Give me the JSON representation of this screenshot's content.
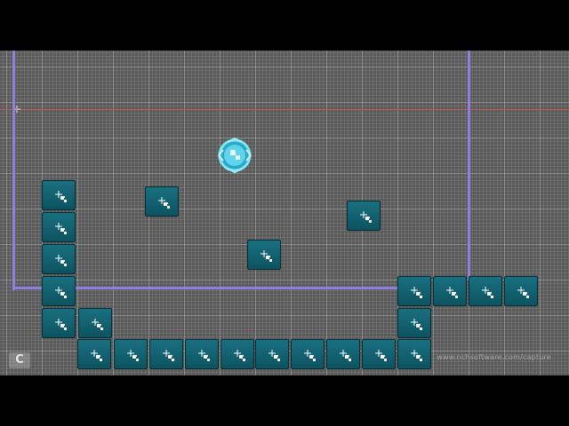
{
  "scene": {
    "background": "#5a5a5a",
    "boundary_color": "#8f7fe0",
    "guide_color": "#dc5a5a",
    "block_color": "#14677a",
    "player_color": "#3cc6e6"
  },
  "icons": {
    "origin": "crosshair-icon",
    "block": "sprite-placeholder-icon",
    "player": "player-sprite-icon"
  },
  "overlay": {
    "watermark": "www.nchsoftware.com/capture",
    "logo": "C"
  }
}
